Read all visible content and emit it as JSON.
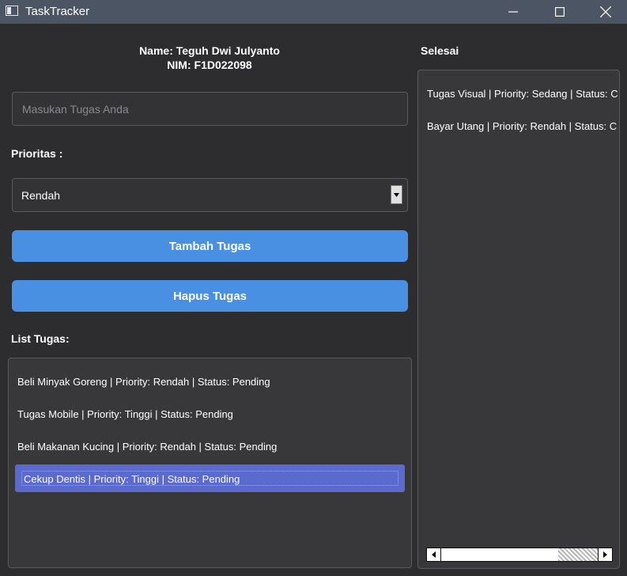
{
  "window": {
    "title": "TaskTracker"
  },
  "header": {
    "name_line": "Name: Teguh Dwi Julyanto",
    "nim_line": "NIM: F1D022098"
  },
  "task_input": {
    "placeholder": "Masukan Tugas Anda",
    "value": ""
  },
  "priority": {
    "label": "Prioritas :",
    "selected": "Rendah"
  },
  "buttons": {
    "add": "Tambah Tugas",
    "delete": "Hapus Tugas"
  },
  "task_list": {
    "label": "List Tugas:",
    "items": [
      "Beli Minyak Goreng | Priority: Rendah | Status: Pending",
      "Tugas Mobile | Priority: Tinggi | Status: Pending",
      "Beli Makanan Kucing | Priority: Rendah | Status: Pending",
      "Cekup Dentis | Priority: Tinggi | Status: Pending"
    ],
    "selected_index": 3
  },
  "done_list": {
    "label": "Selesai",
    "items": [
      "Tugas Visual | Priority: Sedang | Status: C",
      "Bayar Utang | Priority: Rendah | Status: C"
    ]
  },
  "colors": {
    "background": "#2d2d30",
    "titlebar": "#4b5563",
    "button": "#4a90e2",
    "selection": "#5a6acf"
  }
}
